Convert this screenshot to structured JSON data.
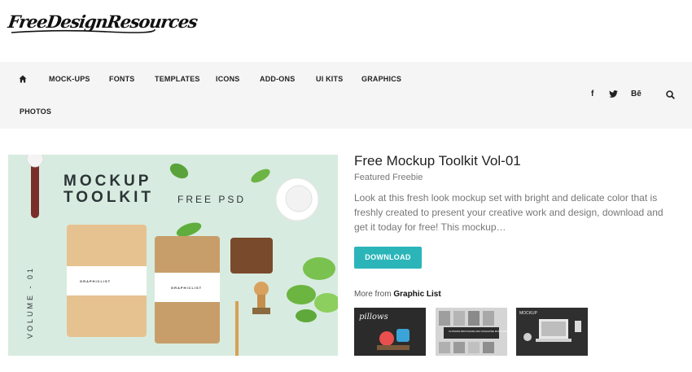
{
  "header": {
    "logo_text": "FreeDesignResources"
  },
  "nav": {
    "items": [
      {
        "label": "MOCK-UPS"
      },
      {
        "label": "FONTS"
      },
      {
        "label": "TEMPLATES"
      },
      {
        "label": "ICONS"
      },
      {
        "label": "ADD-ONS"
      },
      {
        "label": "UI KITS"
      },
      {
        "label": "GRAPHICS"
      },
      {
        "label": "PHOTOS"
      }
    ],
    "social": {
      "facebook": "f",
      "twitter": "🐦",
      "behance": "Bē"
    }
  },
  "hero": {
    "title_line1": "MOCKUP",
    "title_line2": "TOOLKIT",
    "subtitle": "FREE PSD",
    "volume": "VOLUME - 01",
    "book_label": "GRAPHICLIST"
  },
  "article": {
    "title": "Free Mockup Toolkit Vol-01",
    "category": "Featured Freebie",
    "description": "Look at this fresh look mockup set with bright and delicate color that is freshly created to present your creative work and design, download and get it today for free! This mockup…",
    "download_label": "DOWNLOAD",
    "more_from_prefix": "More from",
    "more_from_author": "Graphic List"
  },
  "thumbnails": [
    {
      "alt": "pillows mockup",
      "text": "pillows"
    },
    {
      "alt": "ultimate brochure and magazine mockups",
      "text": "ULTIMATE BROCHURE AND MAGAZINE MOCKUPS"
    },
    {
      "alt": "laptop mockup",
      "text": "MOCKUP"
    }
  ],
  "colors": {
    "accent": "#2bb5b9",
    "nav_bg": "#f5f5f5",
    "hero_bg": "#d8ebe0"
  }
}
